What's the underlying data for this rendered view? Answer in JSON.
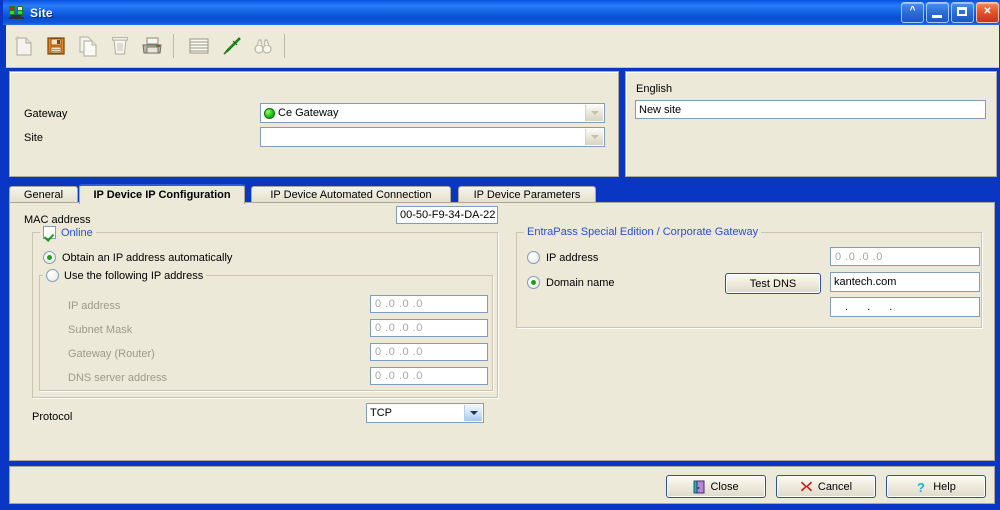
{
  "window": {
    "title": "Site",
    "icon": "site-monitor-icon",
    "buttons": {
      "rollup": "^",
      "minimize": "_",
      "maximize": "□",
      "close": "✕"
    }
  },
  "toolbar": {
    "items": [
      {
        "name": "new-icon",
        "label": "New",
        "enabled": false
      },
      {
        "name": "save-icon",
        "label": "Save",
        "enabled": true
      },
      {
        "name": "copy-icon",
        "label": "Copy",
        "enabled": false
      },
      {
        "name": "delete-icon",
        "label": "Delete",
        "enabled": false
      },
      {
        "name": "print-icon",
        "label": "Print",
        "enabled": true
      },
      {
        "name": "list-icon",
        "label": "List",
        "enabled": true
      },
      {
        "name": "edit-pen-icon",
        "label": "Edit",
        "enabled": true
      },
      {
        "name": "search-binoculars-icon",
        "label": "Search",
        "enabled": false
      }
    ]
  },
  "selector": {
    "gateway_label": "Gateway",
    "gateway_value": "Ce Gateway",
    "gateway_status_color": "#22C413",
    "site_label": "Site",
    "site_value": ""
  },
  "language": {
    "label": "English",
    "value": "New site"
  },
  "tabs": [
    {
      "label": "General",
      "active": false
    },
    {
      "label": "IP Device IP Configuration",
      "active": true
    },
    {
      "label": "IP Device Automated Connection",
      "active": false
    },
    {
      "label": "IP Device Parameters",
      "active": false
    }
  ],
  "mac": {
    "label": "MAC address",
    "value": "00-50-F9-34-DA-22"
  },
  "online": {
    "label": "Online",
    "checked": true,
    "label_color": "#2A4FCF"
  },
  "ip_mode": {
    "auto_label": "Obtain an IP address automatically",
    "auto_selected": true,
    "manual_label": "Use the following IP address",
    "manual_selected": false,
    "fields": [
      {
        "label": "IP address",
        "value": "0  .0  .0  .0"
      },
      {
        "label": "Subnet Mask",
        "value": "0  .0  .0  .0"
      },
      {
        "label": "Gateway (Router)",
        "value": "0  .0  .0  .0"
      },
      {
        "label": "DNS server address",
        "value": "0  .0  .0  .0"
      }
    ]
  },
  "protocol": {
    "label": "Protocol",
    "value": "TCP"
  },
  "entrapass": {
    "title": "EntraPass Special Edition / Corporate Gateway",
    "title_color": "#2A4FCF",
    "ip_label": "IP address",
    "ip_selected": false,
    "ip_value": "0  .0  .0  .0",
    "domain_label": "Domain name",
    "domain_selected": true,
    "domain_value": "kantech.com",
    "test_dns_label": "Test DNS",
    "resolved_value": ".     .     ."
  },
  "footer": {
    "close_label": "Close",
    "cancel_label": "Cancel",
    "help_label": "Help"
  }
}
